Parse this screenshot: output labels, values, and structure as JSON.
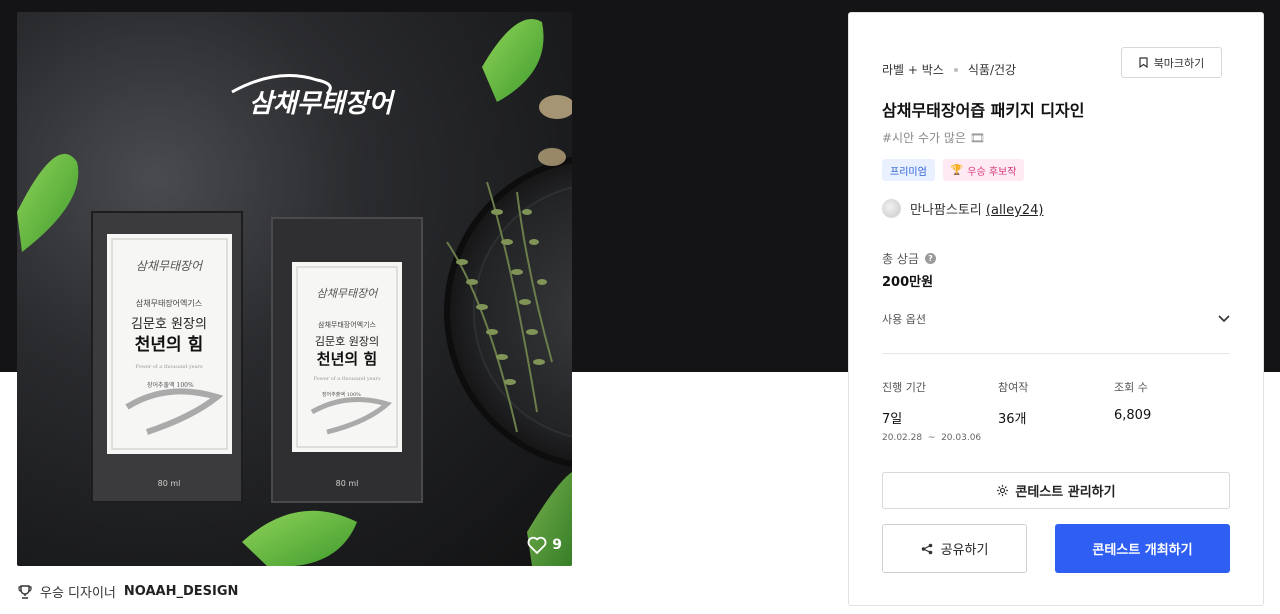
{
  "artwork": {
    "brand_logo_top": "삼채무태장어",
    "left_box": {
      "logo": "삼채무태장어",
      "subtitle": "삼채무태장어엑기스",
      "line1": "김문호 원장의",
      "line2": "천년의 힘",
      "english": "Power of a thousand years",
      "content_note": "장어추출액 100%",
      "volume": "80 ml"
    },
    "right_box": {
      "logo": "삼채무태장어",
      "subtitle": "삼채무태장어엑기스",
      "line1": "김문호 원장의",
      "line2": "천년의 힘",
      "english": "Power of a thousand years",
      "content_note": "장어추출액 100%",
      "volume": "80 ml"
    },
    "like_count": "9"
  },
  "winner": {
    "label": "우승 디자이너",
    "name": "NOAAH_DESIGN"
  },
  "panel": {
    "category_primary": "라벨 + 박스",
    "category_secondary": "식품/건강",
    "bookmark_label": "북마크하기",
    "title": "삼채무태장어즙 패키지 디자인",
    "tags": "#시안 수가 많은 🎞",
    "badges": {
      "premium": "프리미엄",
      "candidate": "우승 후보작"
    },
    "host_name": "만나팜스토리",
    "host_id": "(alley24)",
    "prize_label": "총 상금",
    "prize_help": "?",
    "prize_value": "200만원",
    "usage_label": "사용 옵션",
    "stats": [
      {
        "label": "진행 기간",
        "value": "7일",
        "sub": "20.02.28  ~  20.03.06"
      },
      {
        "label": "참여작",
        "value": "36개"
      },
      {
        "label": "조회 수",
        "value": "6,809"
      }
    ],
    "manage_label": "콘테스트 관리하기",
    "share_label": "공유하기",
    "host_contest_label": "콘테스트 개최하기"
  },
  "colors": {
    "hero_bg": "#141416",
    "primary_button": "#2e5ef2",
    "premium_badge": "#2a5fd6",
    "candidate_badge": "#d63a7c"
  }
}
